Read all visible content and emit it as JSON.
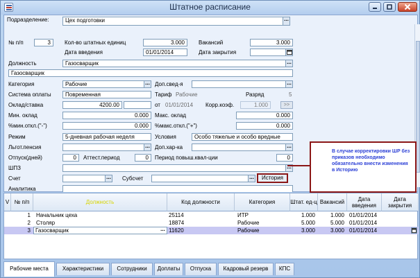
{
  "window": {
    "title": "Штатное расписание"
  },
  "colors": {
    "accent_border": "#8b1616",
    "callout_text": "#2b3fd6",
    "selected_row": "#c8c8f3",
    "active_column": "#d7d400"
  },
  "form": {
    "subdivision": {
      "label": "Подразделение:",
      "value": "Цех подготовки"
    },
    "num": {
      "label": "№ п/п",
      "value": "3"
    },
    "staff_units": {
      "label": "Кол-во штатных единиц",
      "value": "3.000"
    },
    "vacancies": {
      "label": "Вакансий",
      "value": "3.000"
    },
    "intro_date": {
      "label": "Дата введения",
      "value": "01/01/2014"
    },
    "close_date": {
      "label": "Дата закрытия",
      "value": ""
    },
    "position": {
      "label": "Должность",
      "value": "Газосварщик",
      "value2": "Газосварщик"
    },
    "category": {
      "label": "Категория",
      "value": "Рабочие"
    },
    "extra_info": {
      "label": "Доп.свед-я",
      "value": ""
    },
    "pay_system": {
      "label": "Система оплаты",
      "value": "Повременная"
    },
    "tariff": {
      "label": "Тариф",
      "value": "Рабочие"
    },
    "grade": {
      "label": "Разряд",
      "value": "5"
    },
    "salary": {
      "label": "Оклад/ставка",
      "value": "4200.00"
    },
    "salary_from": {
      "label": "от",
      "value": "01/01/2014"
    },
    "corr_coef": {
      "label": "Корр.коэф.",
      "value": "1.000",
      "btn": ">>"
    },
    "min_salary": {
      "label": "Мин. оклад",
      "value": "0.000"
    },
    "max_salary": {
      "label": "Макс. оклад",
      "value": "0.000"
    },
    "min_dev": {
      "label": "%мин.откл.(\"-\")",
      "value": "0.000"
    },
    "max_dev": {
      "label": "%макс.откл.(\"+\")",
      "value": "0.000"
    },
    "regime": {
      "label": "Режим",
      "value": "5-дневная рабочая неделя"
    },
    "conditions": {
      "label": "Условия",
      "value": "Особо тяжелые и особо вредные"
    },
    "pension": {
      "label": "Льгот.пенсия",
      "value": ""
    },
    "extra_char": {
      "label": "Доп.хар-ка",
      "value": ""
    },
    "vacation": {
      "label": "Отпуск(дней)",
      "value": "0"
    },
    "attest": {
      "label": "Аттест.период",
      "value": "0"
    },
    "qual_period": {
      "label": "Период повыш.квал-ции",
      "value": "0"
    },
    "shpz": {
      "label": "ШПЗ",
      "value": ""
    },
    "account": {
      "label": "Счет",
      "value": ""
    },
    "subaccount": {
      "label": "Субсчет",
      "value": ""
    },
    "analytics": {
      "label": "Аналитика",
      "value": ""
    },
    "history_button": "История"
  },
  "callout": "В случае корректировки ШР без приказов необходимо обязательно внести изменения в Историю",
  "grid": {
    "headers": [
      "V",
      "№ п/п",
      "Должность",
      "Код должности",
      "Категория",
      "Штат. ед-ц",
      "Вакансий",
      "Дата введения",
      "Дата закрытия"
    ],
    "rows": [
      {
        "num": "1",
        "position": "Начальник цеха",
        "code": "25114",
        "category": "ИТР",
        "units": "1.000",
        "vacancies": "1.000",
        "intro": "01/01/2014",
        "close": ""
      },
      {
        "num": "2",
        "position": "Столяр",
        "code": "18874",
        "category": "Рабочие",
        "units": "5.000",
        "vacancies": "5.000",
        "intro": "01/01/2014",
        "close": ""
      },
      {
        "num": "3",
        "position": "Газосварщик",
        "code": "11620",
        "category": "Рабочие",
        "units": "3.000",
        "vacancies": "3.000",
        "intro": "01/01/2014",
        "close": ""
      }
    ]
  },
  "tabs": [
    "Рабочие места",
    "Характеристики",
    "Сотрудники",
    "Доплаты",
    "Отпуска",
    "Кадровый резерв",
    "КПС"
  ]
}
